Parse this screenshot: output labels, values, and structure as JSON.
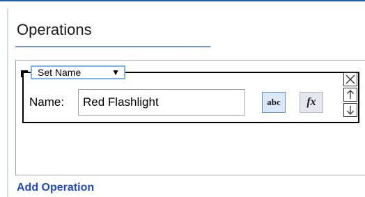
{
  "section": {
    "title": "Operations"
  },
  "operation": {
    "type_selected": "Set Name",
    "name_label": "Name:",
    "name_value": "Red Flashlight",
    "text_mode_button": "abc",
    "formula_button": "fx"
  },
  "side_controls": {
    "icons": [
      "close-icon",
      "arrow-up-icon",
      "arrow-down-icon"
    ]
  },
  "footer": {
    "add_operation_label": "Add Operation"
  },
  "colors": {
    "accent_blue": "#1f5fae",
    "link_blue": "#1f49c8",
    "select_border": "#7db3e6",
    "text_mode_fill": "#dbe8f7"
  }
}
